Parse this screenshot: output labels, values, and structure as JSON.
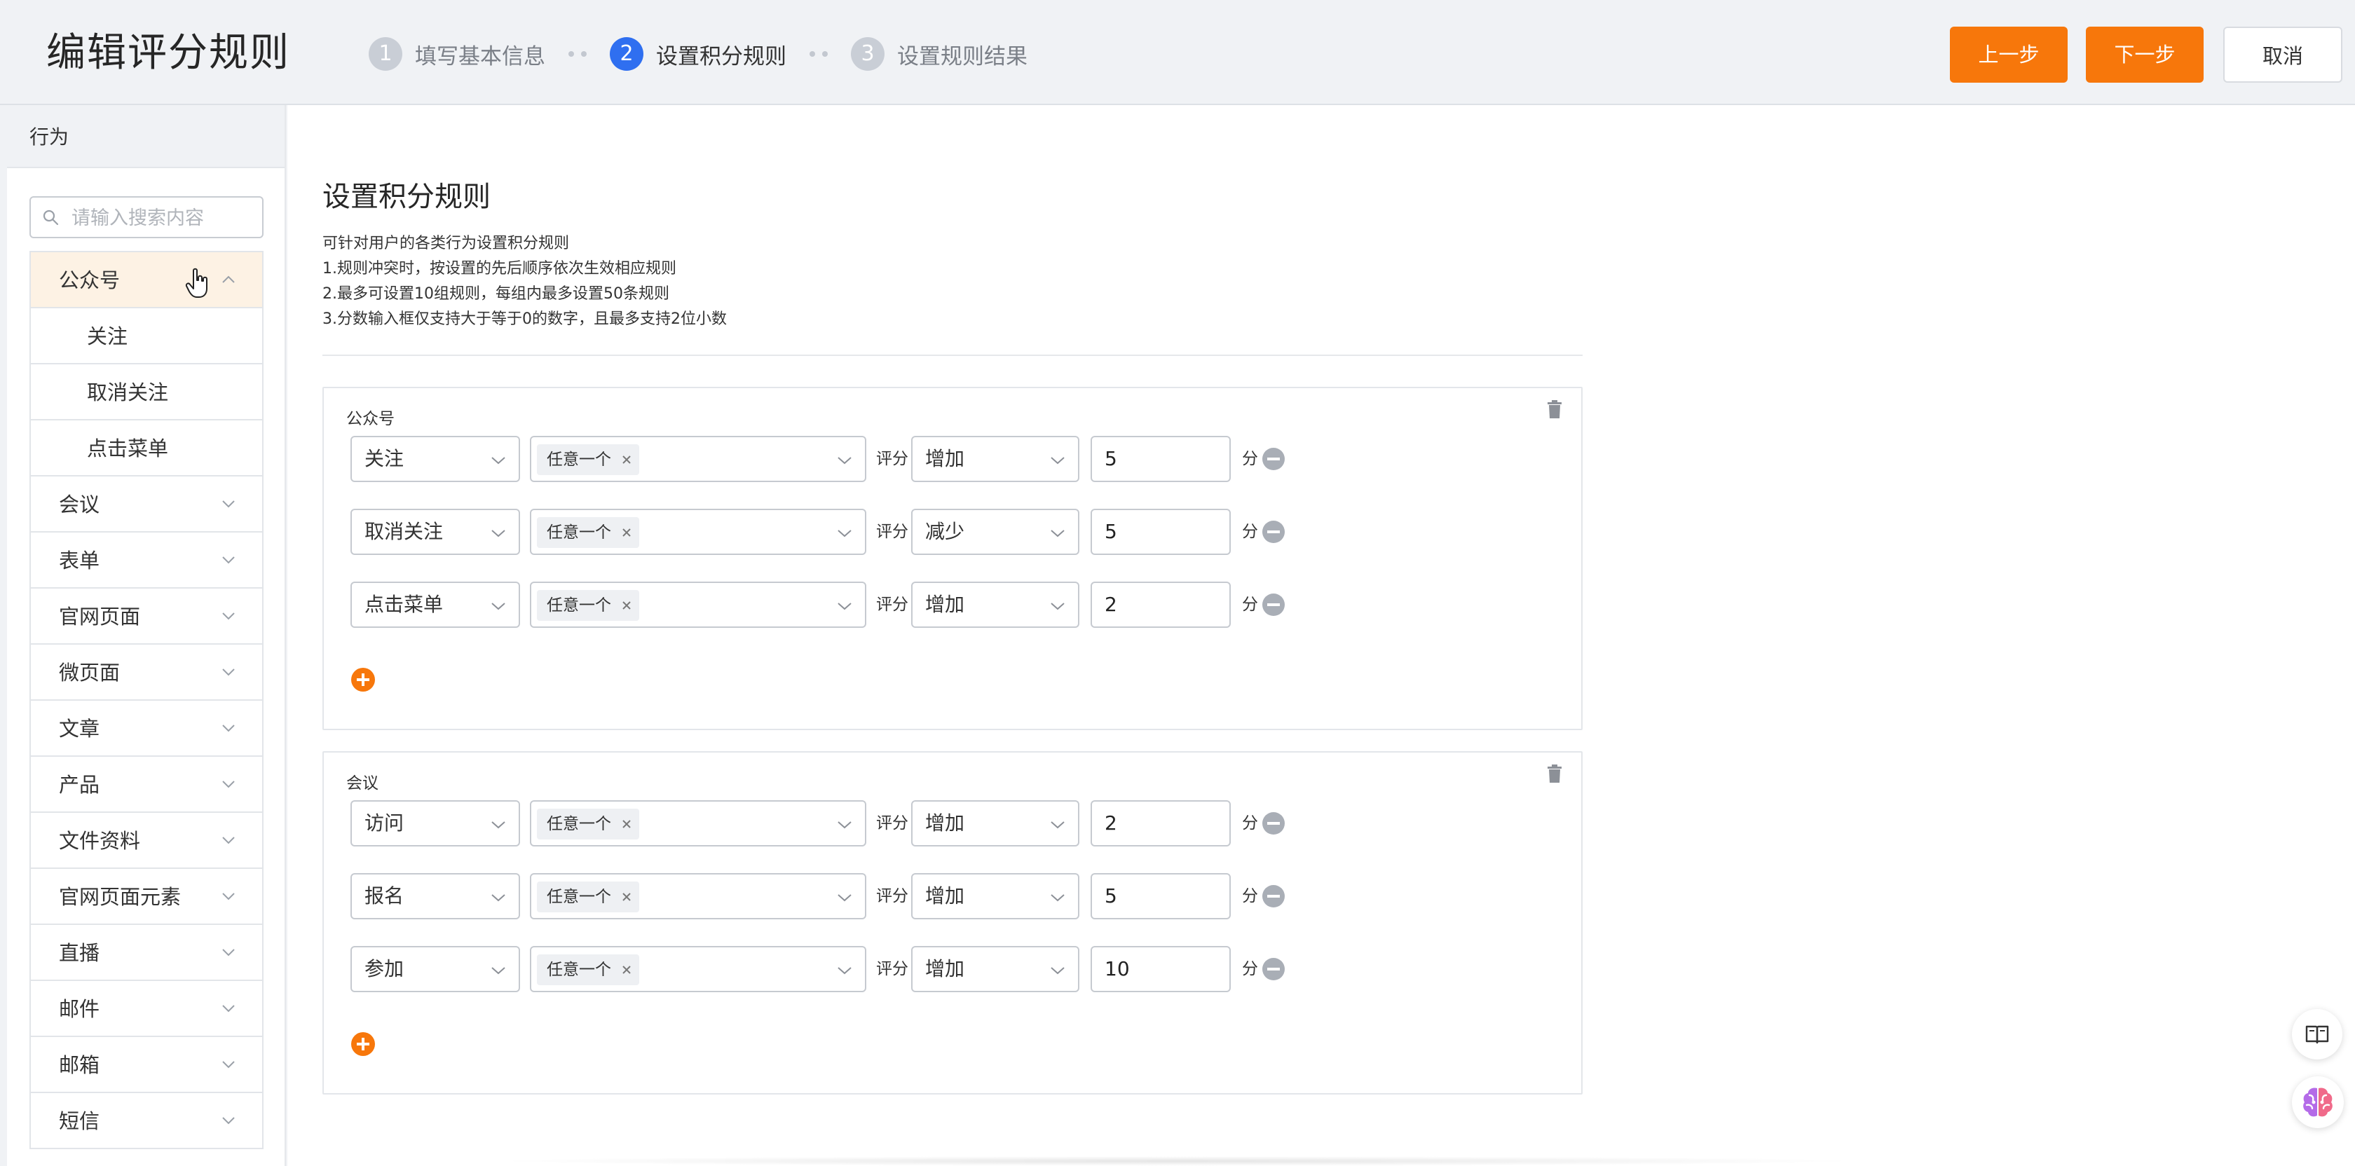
{
  "header": {
    "title": "编辑评分规则",
    "steps": [
      {
        "num": "1",
        "label": "填写基本信息"
      },
      {
        "num": "2",
        "label": "设置积分规则"
      },
      {
        "num": "3",
        "label": "设置规则结果"
      }
    ],
    "active_step": 2,
    "prev_label": "上一步",
    "next_label": "下一步",
    "cancel_label": "取消"
  },
  "sidebar": {
    "title": "行为",
    "search_placeholder": "请输入搜索内容",
    "categories": [
      {
        "label": "公众号",
        "expanded": true,
        "children": [
          "关注",
          "取消关注",
          "点击菜单"
        ]
      },
      {
        "label": "会议"
      },
      {
        "label": "表单"
      },
      {
        "label": "官网页面"
      },
      {
        "label": "微页面"
      },
      {
        "label": "文章"
      },
      {
        "label": "产品"
      },
      {
        "label": "文件资料"
      },
      {
        "label": "官网页面元素"
      },
      {
        "label": "直播"
      },
      {
        "label": "邮件"
      },
      {
        "label": "邮箱"
      },
      {
        "label": "短信"
      }
    ]
  },
  "main": {
    "section_title": "设置积分规则",
    "description": [
      "可针对用户的各类行为设置积分规则",
      "1.规则冲突时，按设置的先后顺序依次生效相应规则",
      "2.最多可设置10组规则，每组内最多设置50条规则",
      "3.分数输入框仅支持大于等于0的数字，且最多支持2位小数"
    ],
    "score_label": "评分",
    "unit_label": "分",
    "groups": [
      {
        "name": "公众号",
        "rules": [
          {
            "action": "关注",
            "condition": "任意一个",
            "direction": "增加",
            "score": "5"
          },
          {
            "action": "取消关注",
            "condition": "任意一个",
            "direction": "减少",
            "score": "5"
          },
          {
            "action": "点击菜单",
            "condition": "任意一个",
            "direction": "增加",
            "score": "2"
          }
        ]
      },
      {
        "name": "会议",
        "rules": [
          {
            "action": "访问",
            "condition": "任意一个",
            "direction": "增加",
            "score": "2"
          },
          {
            "action": "报名",
            "condition": "任意一个",
            "direction": "增加",
            "score": "5"
          },
          {
            "action": "参加",
            "condition": "任意一个",
            "direction": "增加",
            "score": "10"
          }
        ]
      }
    ]
  },
  "colors": {
    "accent": "#f7770b",
    "step_active": "#2f6ff0",
    "step_inactive": "#c9ced6",
    "sidebar_active_bg": "#fdf2e4",
    "remove": "#a9aeb6"
  },
  "icons": [
    "search-icon",
    "chevron-up-icon",
    "chevron-down-icon",
    "trash-icon",
    "close-icon",
    "remove-circle-icon",
    "add-circle-icon",
    "book-icon",
    "brain-icon",
    "hand-cursor-icon"
  ]
}
